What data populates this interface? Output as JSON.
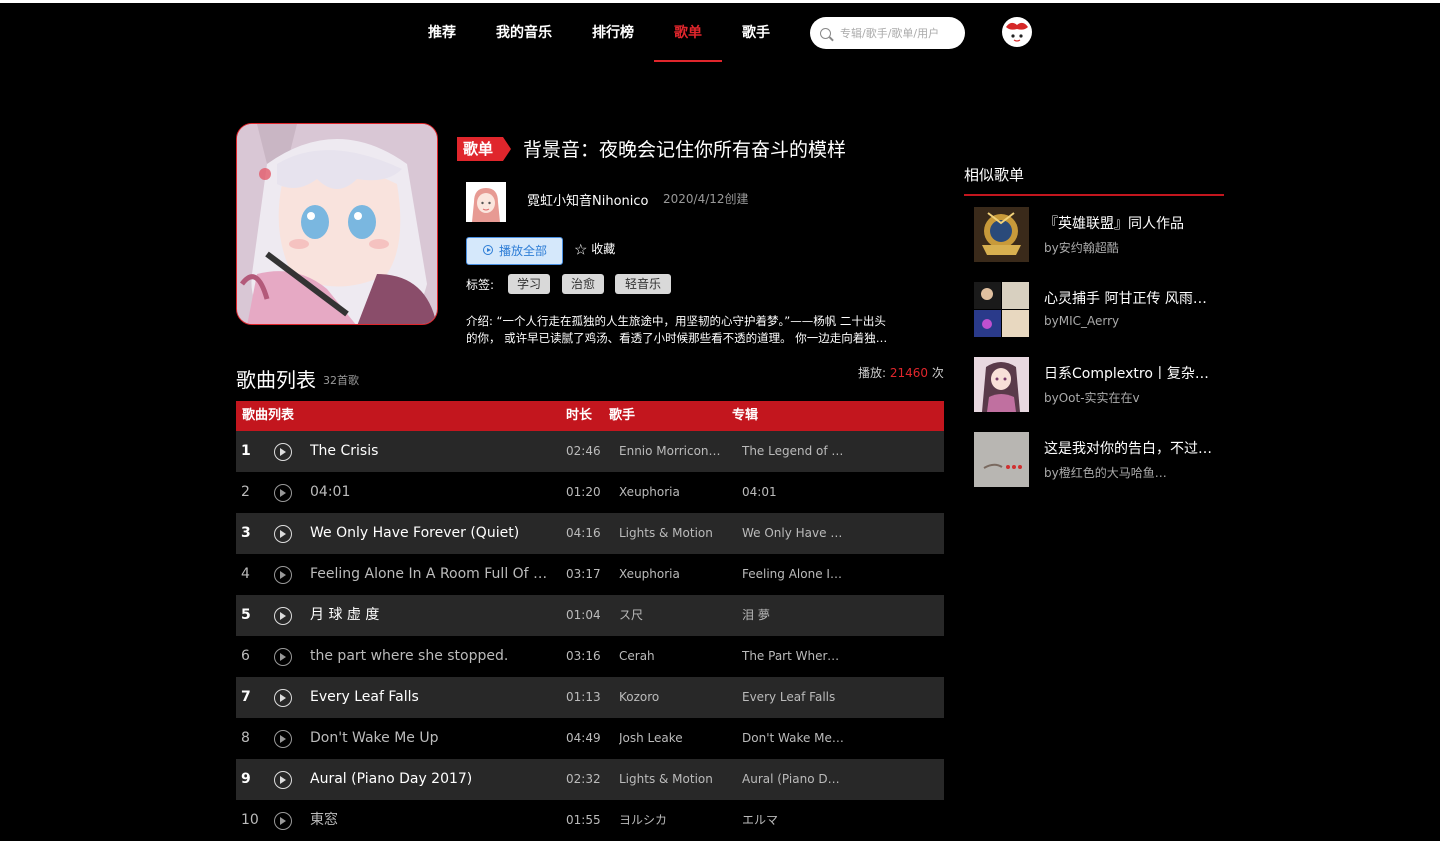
{
  "nav": {
    "items": [
      {
        "label": "推荐"
      },
      {
        "label": "我的音乐"
      },
      {
        "label": "排行榜"
      },
      {
        "label": "歌单"
      },
      {
        "label": "歌手"
      }
    ],
    "active": "歌单",
    "search_placeholder": "专辑/歌手/歌单/用户"
  },
  "playlist": {
    "badge": "歌单",
    "title": "背景音：夜晚会记住你所有奋斗的模样",
    "creator": "霓虹小知音Nihonico",
    "created": "2020/4/12创建",
    "play_all": "播放全部",
    "collect": "收藏",
    "tags_label": "标签:",
    "tags": [
      "学习",
      "治愈",
      "轻音乐"
    ],
    "intro_line1": "介绍: “一个人行走在孤独的人生旅途中，用坚韧的心守护着梦。”——杨帆 二十出头",
    "intro_line2": "的你， 或许早已读腻了鸡汤、看透了小时候那些看不透的道理。 你一边走向着独…"
  },
  "list": {
    "title": "歌曲列表",
    "count": "32首歌",
    "play_label": "播放:",
    "play_num": "21460",
    "play_unit": "次",
    "headers": {
      "name": "歌曲列表",
      "duration": "时长",
      "artist": "歌手",
      "album": "专辑"
    },
    "rows": [
      {
        "idx": "1",
        "song": "The Crisis",
        "duration": "02:46",
        "artist": "Ennio Morricon…",
        "album": "The Legend of …"
      },
      {
        "idx": "2",
        "song": "04:01",
        "duration": "01:20",
        "artist": "Xeuphoria",
        "album": "04:01"
      },
      {
        "idx": "3",
        "song": "We Only Have Forever (Quiet)",
        "duration": "04:16",
        "artist": "Lights & Motion",
        "album": "We Only Have …"
      },
      {
        "idx": "4",
        "song": "Feeling Alone In A Room Full Of P…",
        "duration": "03:17",
        "artist": "Xeuphoria",
        "album": "Feeling Alone I…"
      },
      {
        "idx": "5",
        "song": "月 球 虚 度",
        "duration": "01:04",
        "artist": "ス尺",
        "album": "泪 夢"
      },
      {
        "idx": "6",
        "song": "the part where she stopped.",
        "duration": "03:16",
        "artist": "Cerah",
        "album": "The Part Where…"
      },
      {
        "idx": "7",
        "song": "Every Leaf Falls",
        "duration": "01:13",
        "artist": "Kozoro",
        "album": "Every Leaf Falls"
      },
      {
        "idx": "8",
        "song": "Don't Wake Me Up",
        "duration": "04:49",
        "artist": "Josh Leake",
        "album": "Don't Wake Me…"
      },
      {
        "idx": "9",
        "song": "Aural (Piano Day 2017)",
        "duration": "02:32",
        "artist": "Lights & Motion",
        "album": "Aural (Piano Da…"
      },
      {
        "idx": "10",
        "song": "東窓",
        "duration": "01:55",
        "artist": "ヨルシカ",
        "album": "エルマ"
      }
    ]
  },
  "sidebar": {
    "title": "相似歌单",
    "items": [
      {
        "name": "『英雄联盟』同人作品",
        "by": "by安约翰超酷"
      },
      {
        "name": "心灵捕手 阿甘正传 风雨…",
        "by": "byMIC_Aerry"
      },
      {
        "name": "日系Complextro丨复杂…",
        "by": "byOot-实实在在v"
      },
      {
        "name": "这是我对你的告白，不过…",
        "by": "by橙红色的大马哈鱼…"
      }
    ]
  },
  "colors": {
    "accent": "#e0262c",
    "header_bar": "#c3161e",
    "row_alt": "#282828"
  }
}
